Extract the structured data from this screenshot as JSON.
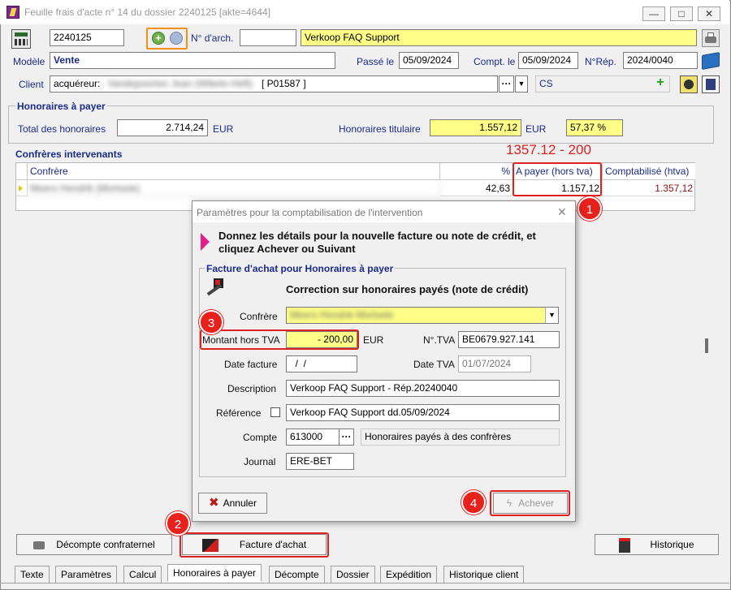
{
  "window": {
    "title": "Feuille frais d'acte n° 14 du dossier 2240125 [akte=4644]",
    "minimize": "—",
    "maximize": "□",
    "close": "✕"
  },
  "header": {
    "dossier_number": "2240125",
    "archive_label": "N° d'arch.",
    "archive_value": "",
    "description": "Verkoop FAQ Support",
    "model_label": "Modèle",
    "model_value": "Vente",
    "passed_label": "Passé le",
    "passed_date": "05/09/2024",
    "compt_label": "Compt. le",
    "compt_date": "05/09/2024",
    "rep_label": "N°Rép.",
    "rep_value": "2024/0040",
    "client_label": "Client",
    "client_prefix": "acquéreur:",
    "client_name": "Vandepoorten Jean (Wibelo-Heft)",
    "client_ref": "[ P01587 ]",
    "client_ellipsis": "···",
    "client_code": "CS"
  },
  "fees": {
    "section_title": "Honoraires à payer",
    "total_label": "Total des honoraires",
    "total_value": "2.714,24",
    "currency": "EUR",
    "holder_label": "Honoraires titulaire",
    "holder_value": "1.557,12",
    "holder_currency": "EUR",
    "holder_percent": "57,37 %"
  },
  "colleagues": {
    "section_title": "Confrères intervenants",
    "annotation": "1357.12 - 200",
    "columns": [
      "Confrère",
      "%",
      "A payer (hors tva)",
      "Comptabilisé (htva)"
    ],
    "rows": [
      {
        "name": "Meers Hendrik (Mortsele)",
        "percent": "42,63",
        "to_pay": "1.157,12",
        "booked": "1.357,12"
      }
    ]
  },
  "dialog": {
    "title": "Paramètres pour la comptabilisation de l'intervention",
    "close": "✕",
    "instruction": "Donnez les détails pour la nouvelle facture ou note de crédit, et cliquez Achever ou Suivant",
    "group_title": "Facture d'achat pour Honoraires à payer",
    "subtitle": "Correction sur honoraires payés (note de crédit)",
    "confrere_label": "Confrère",
    "confrere_value": "Meers Hendrik Mortsele",
    "amount_label": "Montant hors TVA",
    "amount_value": "- 200,00",
    "amount_currency": "EUR",
    "vat_label": "N°.TVA",
    "vat_value": "BE0679.927.141",
    "invoice_date_label": "Date facture",
    "invoice_date_value": "  /  /",
    "vat_date_label": "Date TVA",
    "vat_date_value": "01/07/2024",
    "description_label": "Description",
    "description_value": "Verkoop FAQ Support - Rép.20240040",
    "reference_label": "Référence",
    "reference_value": "Verkoop FAQ Support dd.05/09/2024",
    "account_label": "Compte",
    "account_value": "613000",
    "account_ellipsis": "···",
    "account_desc": "Honoraires payés à des confrères",
    "journal_label": "Journal",
    "journal_value": "ERE-BET",
    "cancel_label": "Annuler",
    "finish_label": "Achever"
  },
  "bottom_buttons": {
    "decompte_label": "Décompte confraternel",
    "facture_label": "Facture d'achat",
    "historique_label": "Historique"
  },
  "markers": [
    "1",
    "2",
    "3",
    "4"
  ],
  "tabs": [
    "Texte",
    "Paramètres",
    "Calcul",
    "Honoraires à payer",
    "Décompte",
    "Dossier",
    "Expédition",
    "Historique client"
  ],
  "colors": {
    "highlight_red": "#e0201e",
    "field_yellow": "#ffff88",
    "label_blue": "#1a2a8a",
    "accent_orange": "#f39019"
  }
}
